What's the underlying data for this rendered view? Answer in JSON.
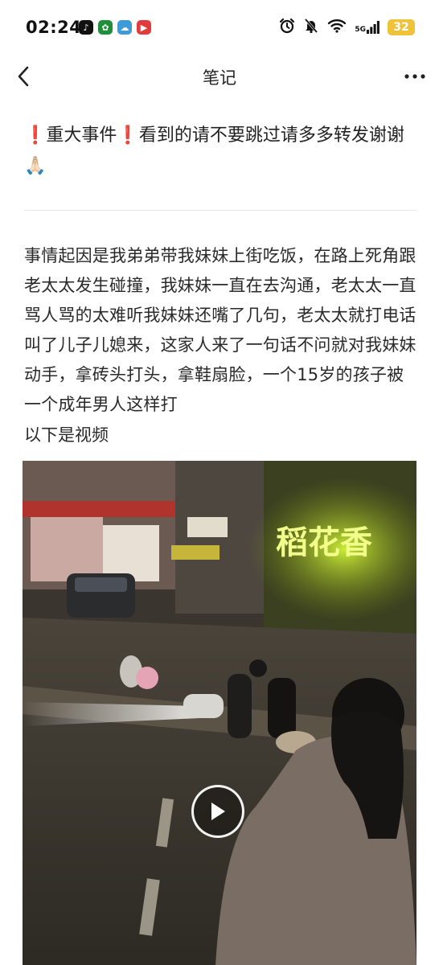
{
  "status_bar": {
    "time": "02:24",
    "network_label": "5G",
    "battery_level": "32"
  },
  "nav": {
    "title": "笔记"
  },
  "post": {
    "title_prefix": "重大事件",
    "title_text": "看到的请不要跳过请多多转发谢谢",
    "title_emoji": "🙏🏻",
    "body": "事情起因是我弟弟带我妹妹上街吃饭，在路上死角跟老太太发生碰撞，我妹妹一直在去沟通，老太太一直骂人骂的太难听我妹妹还嘴了几句，老太太就打电话叫了儿子儿媳来，这家人来了一句话不问就对我妹妹动手，拿砖头打头，拿鞋扇脸，一个15岁的孩子被一个成年男人这样打",
    "video_caption": "以下是视频"
  },
  "video": {
    "shop_sign": "稻花香"
  },
  "colors": {
    "accent_red": "#e5393a",
    "battery_yellow": "#f0c23a",
    "sign_glow": "#e4ff3a"
  }
}
